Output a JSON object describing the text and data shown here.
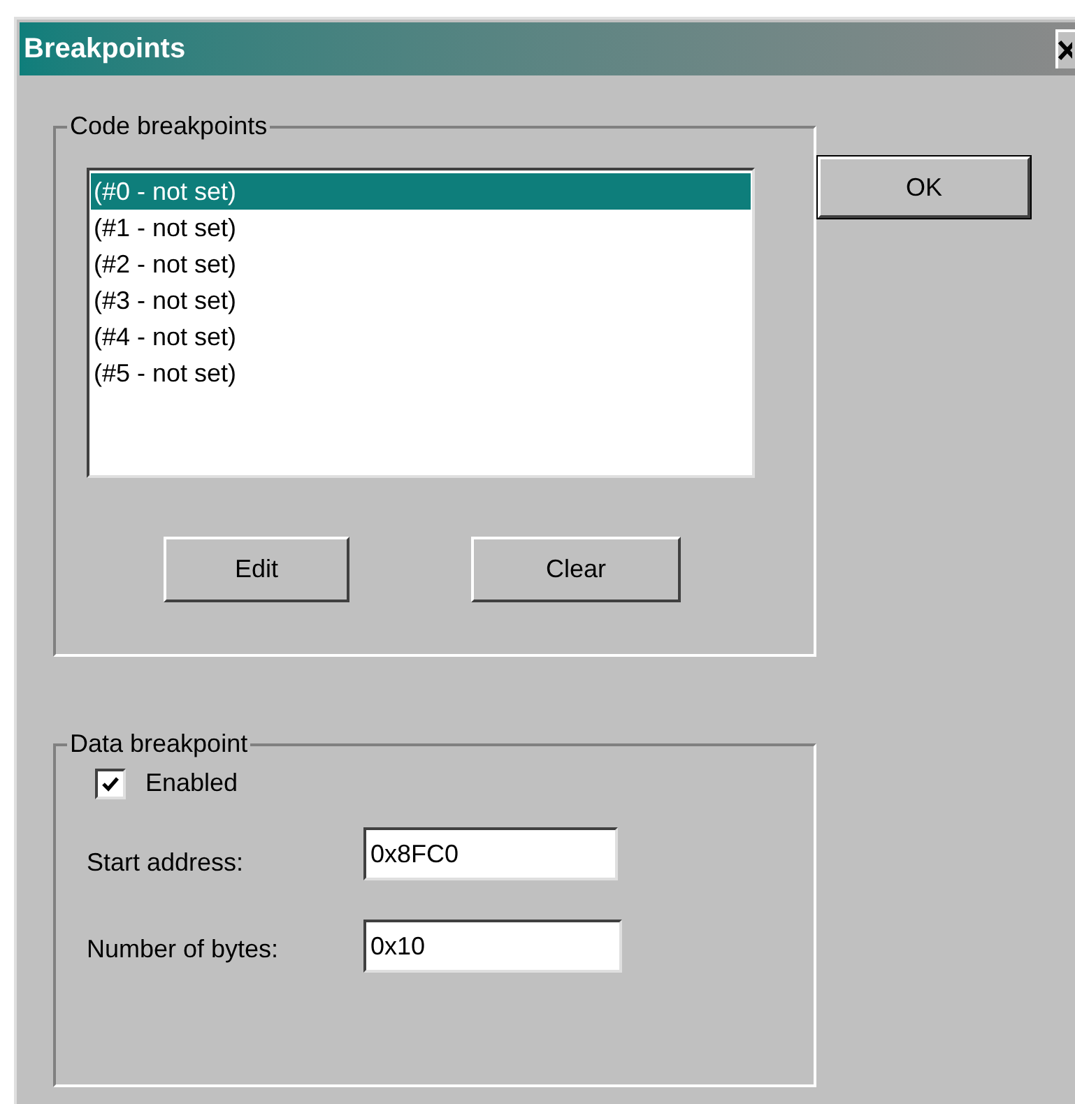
{
  "window": {
    "title": "Breakpoints"
  },
  "code_breakpoints": {
    "title": "Code breakpoints",
    "items": [
      {
        "label": "(#0 - not set)",
        "selected": true
      },
      {
        "label": "(#1 - not set)",
        "selected": false
      },
      {
        "label": "(#2 - not set)",
        "selected": false
      },
      {
        "label": "(#3 - not set)",
        "selected": false
      },
      {
        "label": "(#4 - not set)",
        "selected": false
      },
      {
        "label": "(#5 - not set)",
        "selected": false
      }
    ],
    "buttons": [
      "Edit",
      "Clear"
    ]
  },
  "ok_button": "OK",
  "data_breakpoint": {
    "title": "Data breakpoint",
    "enabled": {
      "label": "Enabled",
      "checked": true
    },
    "start_address": {
      "label": "Start address:",
      "value": "0x8FC0"
    },
    "number_of_bytes": {
      "label": "Number of bytes:",
      "value": "0x10"
    }
  }
}
